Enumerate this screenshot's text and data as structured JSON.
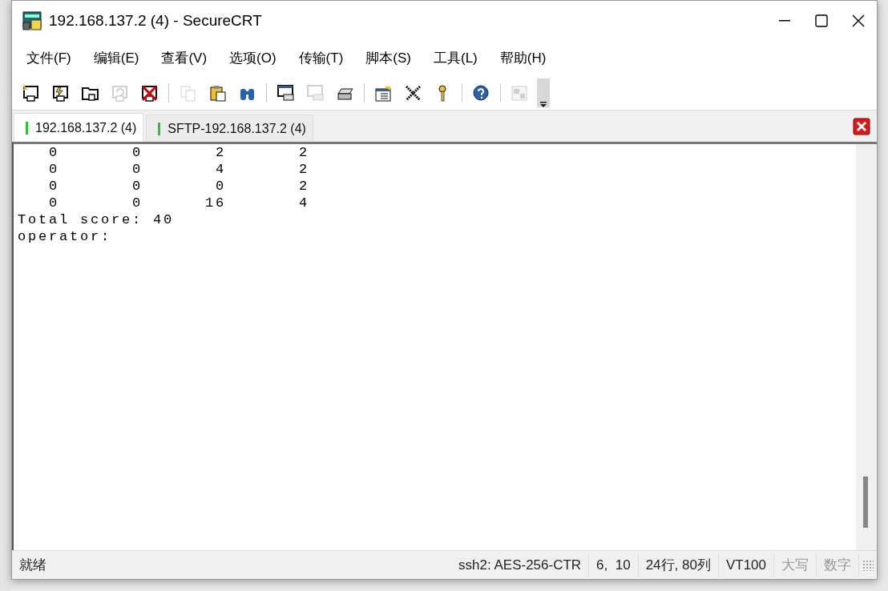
{
  "window": {
    "title": "192.168.137.2 (4) - SecureCRT"
  },
  "menu": [
    "文件(F)",
    "编辑(E)",
    "查看(V)",
    "选项(O)",
    "传输(T)",
    "脚本(S)",
    "工具(L)",
    "帮助(H)"
  ],
  "toolbar": [
    {
      "kind": "quick-connect",
      "disabled": false
    },
    {
      "kind": "connect-tab",
      "disabled": false
    },
    {
      "kind": "connect",
      "disabled": false
    },
    {
      "kind": "reconnect",
      "disabled": true
    },
    {
      "kind": "disconnect",
      "disabled": false
    },
    {
      "kind": "separator"
    },
    {
      "kind": "copy",
      "disabled": true
    },
    {
      "kind": "paste",
      "disabled": false
    },
    {
      "kind": "find",
      "disabled": false
    },
    {
      "kind": "separator"
    },
    {
      "kind": "print-screen",
      "disabled": false
    },
    {
      "kind": "print-selection",
      "disabled": true
    },
    {
      "kind": "print",
      "disabled": false
    },
    {
      "kind": "separator"
    },
    {
      "kind": "session-options",
      "disabled": false
    },
    {
      "kind": "global-options",
      "disabled": false
    },
    {
      "kind": "keymap",
      "disabled": false
    },
    {
      "kind": "separator"
    },
    {
      "kind": "help",
      "disabled": false
    },
    {
      "kind": "separator"
    },
    {
      "kind": "tile",
      "disabled": true
    }
  ],
  "tabs": [
    {
      "label": "192.168.137.2 (4)",
      "selected": true,
      "connected": true
    },
    {
      "label": "SFTP-192.168.137.2 (4)",
      "selected": false,
      "connected": true
    }
  ],
  "terminal": {
    "lines": [
      "   0       0       2       2",
      "   0       0       4       2",
      "   0       0       0       2",
      "   0       0      16       4",
      "Total score: 40",
      "operator:"
    ]
  },
  "status_bar": [
    {
      "text": "就绪",
      "disabled": false
    },
    {
      "text": "ssh2: AES-256-CTR",
      "disabled": false
    },
    {
      "text": "6,  10",
      "disabled": false
    },
    {
      "text": "24行, 80列",
      "disabled": false
    },
    {
      "text": "VT100",
      "disabled": false
    },
    {
      "text": "大写",
      "disabled": true
    },
    {
      "text": "数字",
      "disabled": true
    }
  ]
}
